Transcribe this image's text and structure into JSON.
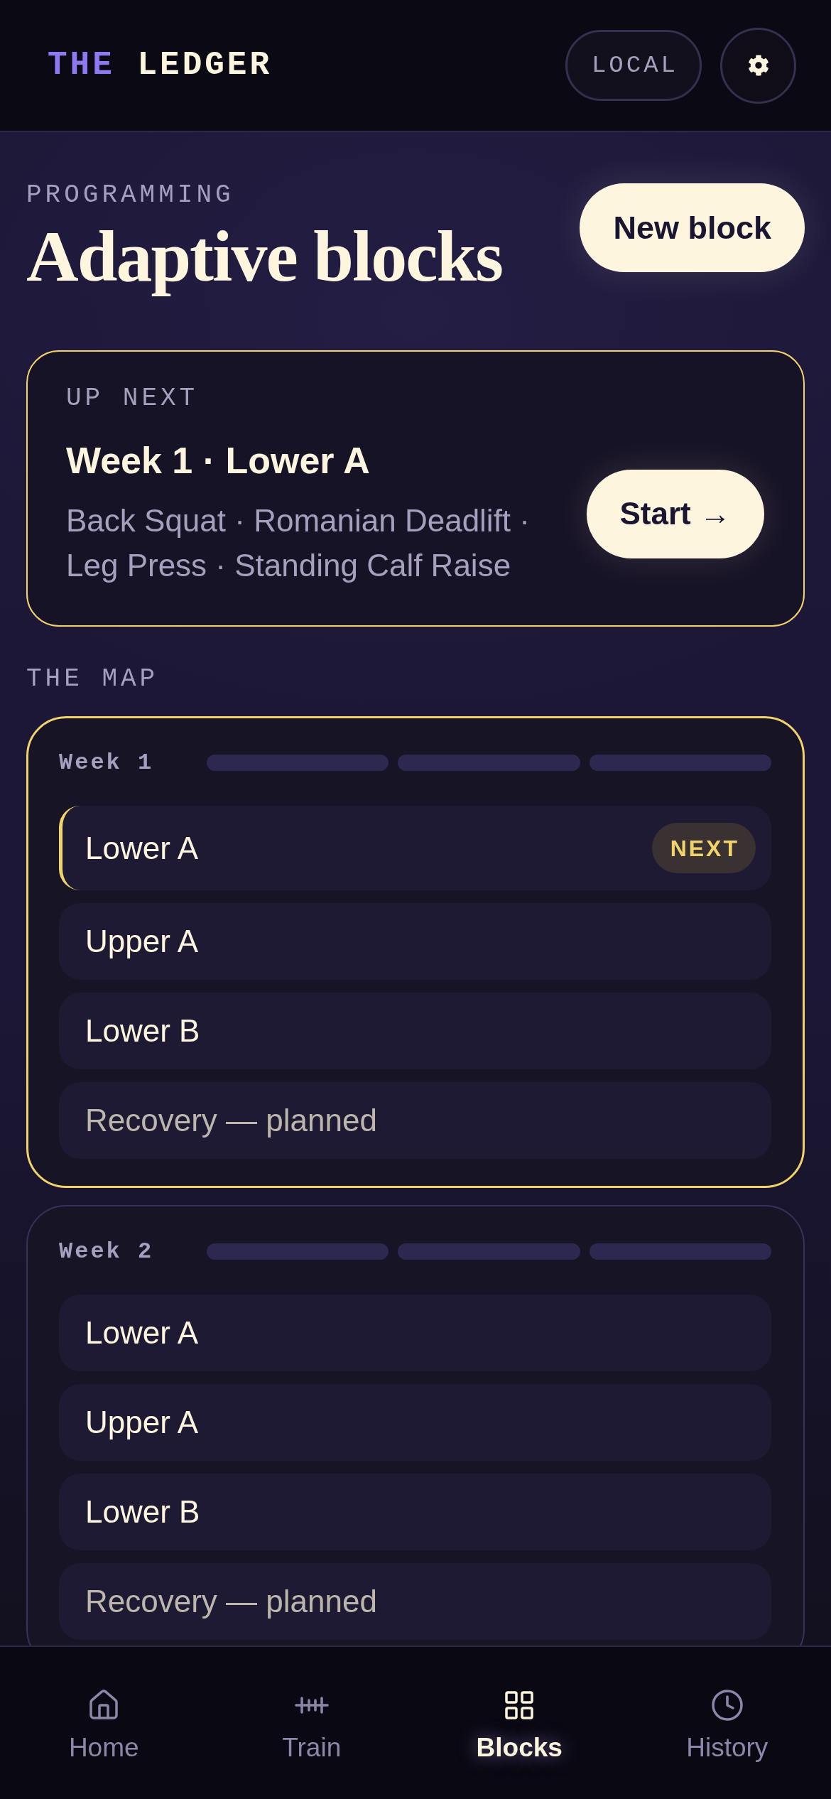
{
  "header": {
    "logo": {
      "prefix": "THE",
      "name": "LEDGER"
    },
    "mode": "LOCAL"
  },
  "page": {
    "eyebrow": "PROGRAMMING",
    "title": "Adaptive blocks",
    "action": "New block"
  },
  "up_next": {
    "label": "UP NEXT",
    "title": "Week 1 · Lower A",
    "exercises": "Back Squat · Romanian Deadlift · Leg Press · Standing Calf Raise",
    "action": "Start →"
  },
  "map": {
    "label": "THE MAP",
    "weeks": [
      {
        "title": "Week 1",
        "current": true,
        "segments": [
          {
            "done": false
          },
          {
            "done": false
          },
          {
            "done": false
          }
        ],
        "sessions": [
          {
            "kind": "session",
            "name": "Lower A",
            "current": true,
            "badge": "NEXT"
          },
          {
            "kind": "session",
            "name": "Upper A",
            "current": false
          },
          {
            "kind": "session",
            "name": "Lower B",
            "current": false
          },
          {
            "kind": "recovery",
            "name": "Recovery — planned",
            "current": false
          }
        ]
      },
      {
        "title": "Week 2",
        "current": false,
        "segments": [
          {
            "done": false
          },
          {
            "done": false
          },
          {
            "done": false
          }
        ],
        "sessions": [
          {
            "kind": "session",
            "name": "Lower A",
            "current": false
          },
          {
            "kind": "session",
            "name": "Upper A",
            "current": false
          },
          {
            "kind": "session",
            "name": "Lower B",
            "current": false
          },
          {
            "kind": "recovery",
            "name": "Recovery — planned",
            "current": false
          }
        ]
      }
    ]
  },
  "nav": [
    {
      "label": "Home",
      "selected": false
    },
    {
      "label": "Train",
      "selected": false
    },
    {
      "label": "Blocks",
      "selected": true
    },
    {
      "label": "History",
      "selected": false
    }
  ]
}
